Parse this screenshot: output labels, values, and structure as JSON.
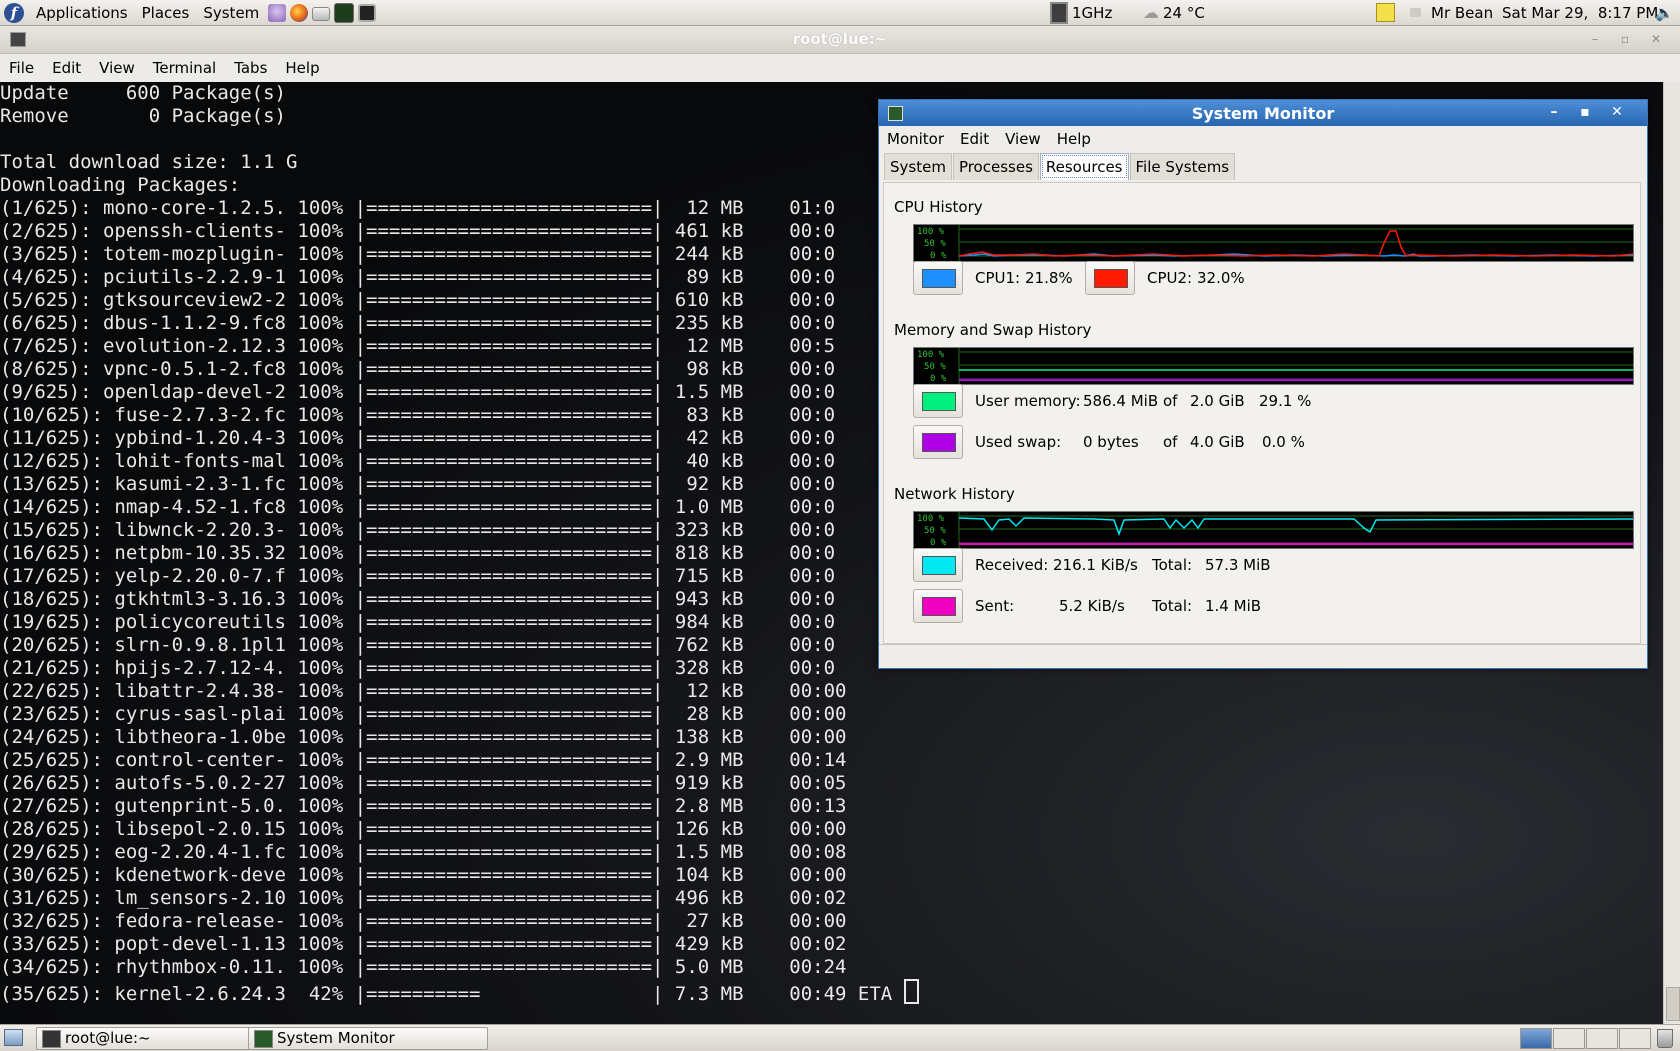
{
  "top_panel": {
    "menus": [
      "Applications",
      "Places",
      "System"
    ],
    "cpu_freq": "1GHz",
    "temperature": "24 °C",
    "user": "Mr Bean",
    "clock": "Sat Mar 29,  8:17 PM"
  },
  "terminal": {
    "title": "root@lue:~",
    "menu": [
      "File",
      "Edit",
      "View",
      "Terminal",
      "Tabs",
      "Help"
    ],
    "lines": [
      "Update     600 Package(s)",
      "Remove       0 Package(s)",
      "",
      "Total download size: 1.1 G",
      "Downloading Packages:",
      "(1/625): mono-core-1.2.5. 100% |=========================|  12 MB    01:0",
      "(2/625): openssh-clients- 100% |=========================| 461 kB    00:0",
      "(3/625): totem-mozplugin- 100% |=========================| 244 kB    00:0",
      "(4/625): pciutils-2.2.9-1 100% |=========================|  89 kB    00:0",
      "(5/625): gtksourceview2-2 100% |=========================| 610 kB    00:0",
      "(6/625): dbus-1.1.2-9.fc8 100% |=========================| 235 kB    00:0",
      "(7/625): evolution-2.12.3 100% |=========================|  12 MB    00:5",
      "(8/625): vpnc-0.5.1-2.fc8 100% |=========================|  98 kB    00:0",
      "(9/625): openldap-devel-2 100% |=========================| 1.5 MB    00:0",
      "(10/625): fuse-2.7.3-2.fc 100% |=========================|  83 kB    00:0",
      "(11/625): ypbind-1.20.4-3 100% |=========================|  42 kB    00:0",
      "(12/625): lohit-fonts-mal 100% |=========================|  40 kB    00:0",
      "(13/625): kasumi-2.3-1.fc 100% |=========================|  92 kB    00:0",
      "(14/625): nmap-4.52-1.fc8 100% |=========================| 1.0 MB    00:0",
      "(15/625): libwnck-2.20.3- 100% |=========================| 323 kB    00:0",
      "(16/625): netpbm-10.35.32 100% |=========================| 818 kB    00:0",
      "(17/625): yelp-2.20.0-7.f 100% |=========================| 715 kB    00:0",
      "(18/625): gtkhtml3-3.16.3 100% |=========================| 943 kB    00:0",
      "(19/625): policycoreutils 100% |=========================| 984 kB    00:0",
      "(20/625): slrn-0.9.8.1pl1 100% |=========================| 762 kB    00:0",
      "(21/625): hpijs-2.7.12-4. 100% |=========================| 328 kB    00:0",
      "(22/625): libattr-2.4.38- 100% |=========================|  12 kB    00:00",
      "(23/625): cyrus-sasl-plai 100% |=========================|  28 kB    00:00",
      "(24/625): libtheora-1.0be 100% |=========================| 138 kB    00:00",
      "(25/625): control-center- 100% |=========================| 2.9 MB    00:14",
      "(26/625): autofs-5.0.2-27 100% |=========================| 919 kB    00:05",
      "(27/625): gutenprint-5.0. 100% |=========================| 2.8 MB    00:13",
      "(28/625): libsepol-2.0.15 100% |=========================| 126 kB    00:00",
      "(29/625): eog-2.20.4-1.fc 100% |=========================| 1.5 MB    00:08",
      "(30/625): kdenetwork-deve 100% |=========================| 104 kB    00:00",
      "(31/625): lm_sensors-2.10 100% |=========================| 496 kB    00:02",
      "(32/625): fedora-release- 100% |=========================|  27 kB    00:00",
      "(33/625): popt-devel-1.13 100% |=========================| 429 kB    00:02",
      "(34/625): rhythmbox-0.11. 100% |=========================| 5.0 MB    00:24",
      "(35/625): kernel-2.6.24.3  42% |==========               | 7.3 MB    00:49 ETA "
    ]
  },
  "sysmon": {
    "title": "System Monitor",
    "menu": [
      "Monitor",
      "Edit",
      "View",
      "Help"
    ],
    "tabs": [
      "System",
      "Processes",
      "Resources",
      "File Systems"
    ],
    "active_tab": "Resources",
    "graph_axis": [
      "100 %",
      "50 %",
      "0 %"
    ],
    "cpu": {
      "title": "CPU History",
      "cpu1_label": "CPU1:",
      "cpu1_value": "21.8%",
      "cpu1_color": "#1e90ff",
      "cpu2_label": "CPU2:",
      "cpu2_value": "32.0%",
      "cpu2_color": "#ff1a00"
    },
    "memory": {
      "title": "Memory and Swap History",
      "user_label": "User memory:",
      "user_used": "586.4 MiB",
      "of1": "of",
      "user_total": "2.0 GiB",
      "user_pct": "29.1 %",
      "user_color": "#00f080",
      "swap_label": "Used swap:",
      "swap_used": "0 bytes",
      "of2": "of",
      "swap_total": "4.0 GiB",
      "swap_pct": "0.0 %",
      "swap_color": "#b000e8"
    },
    "network": {
      "title": "Network History",
      "recv_label": "Received:",
      "recv_rate": "216.1 KiB/s",
      "recv_total_label": "Total:",
      "recv_total": "57.3 MiB",
      "recv_color": "#00e8f0",
      "sent_label": "Sent:",
      "sent_rate": "5.2 KiB/s",
      "sent_total_label": "Total:",
      "sent_total": "1.4 MiB",
      "sent_color": "#f000c0"
    }
  },
  "taskbar": {
    "tasks": [
      "root@lue:~",
      "System Monitor"
    ]
  }
}
